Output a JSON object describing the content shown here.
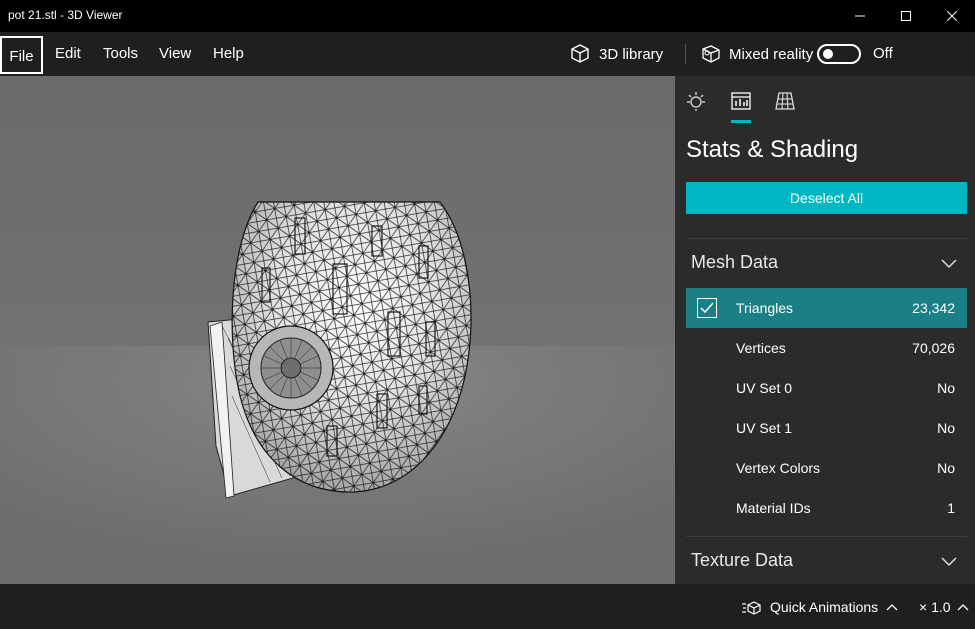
{
  "window": {
    "title": "pot 21.stl - 3D Viewer"
  },
  "menu": {
    "items": [
      "File",
      "Edit",
      "Tools",
      "View",
      "Help"
    ]
  },
  "toolbar": {
    "library_label": "3D library",
    "mixed_reality_label": "Mixed reality",
    "toggle_state": "Off"
  },
  "panel": {
    "title": "Stats & Shading",
    "deselect_label": "Deselect All",
    "mesh_section": "Mesh Data",
    "rows": [
      {
        "label": "Triangles",
        "value": "23,342"
      },
      {
        "label": "Vertices",
        "value": "70,026"
      },
      {
        "label": "UV Set 0",
        "value": "No"
      },
      {
        "label": "UV Set 1",
        "value": "No"
      },
      {
        "label": "Vertex Colors",
        "value": "No"
      },
      {
        "label": "Material IDs",
        "value": "1"
      }
    ],
    "texture_section": "Texture Data"
  },
  "status": {
    "quick_animations": "Quick Animations",
    "zoom": "× 1.0"
  },
  "colors": {
    "accent": "#00b7c3",
    "selected_row": "#1b7f88"
  },
  "icons": [
    "minimize-icon",
    "maximize-icon",
    "close-icon",
    "cube-icon",
    "mixed-reality-icon",
    "sun-icon",
    "stats-icon",
    "grid-icon",
    "chevron-down-icon",
    "chevron-up-icon",
    "checkbox-icon",
    "animation-icon"
  ]
}
